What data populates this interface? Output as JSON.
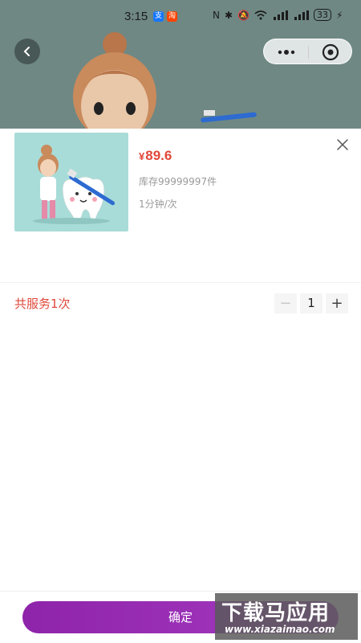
{
  "status_bar": {
    "time": "3:15",
    "app_badges": [
      {
        "label": "支",
        "color": "#1677ff"
      },
      {
        "label": "淘",
        "color": "#ff4400"
      }
    ],
    "battery": "33"
  },
  "nav": {
    "back_icon": "chevron-left-icon",
    "more_icon": "more-dots-icon",
    "target_icon": "target-circle-icon"
  },
  "product": {
    "currency": "¥",
    "price": "89.6",
    "stock": "库存99999997件",
    "duration": "1分钟/次",
    "image_icon": "tooth-brushing-illustration"
  },
  "service": {
    "label": "共服务1次",
    "quantity": "1",
    "minus": "−",
    "plus": "+"
  },
  "confirm_label": "确定",
  "watermark": {
    "title": "下载马应用",
    "url": "www.xiazaimao.com"
  },
  "colors": {
    "accent_red": "#e0483a",
    "confirm_purple": "#9c2fb8"
  }
}
